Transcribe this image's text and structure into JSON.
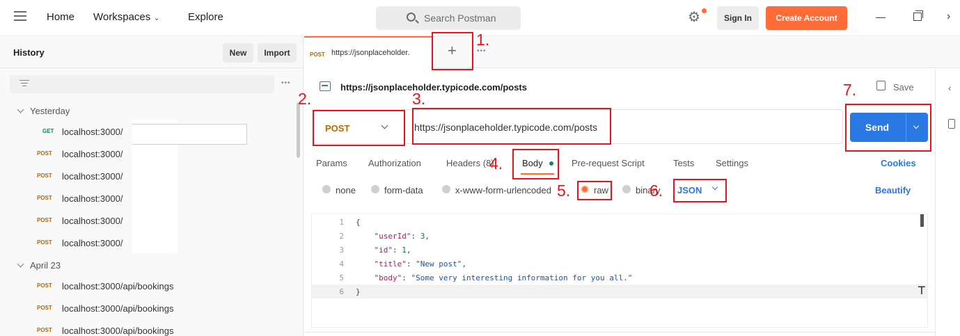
{
  "topbar": {
    "nav": [
      "Home",
      "Workspaces",
      "Explore"
    ],
    "search_placeholder": "Search Postman",
    "sign_in": "Sign In",
    "create_account": "Create Account",
    "close_glyph": "›"
  },
  "sidebar": {
    "title": "History",
    "new": "New",
    "import": "Import",
    "groups": [
      {
        "label": "Yesterday",
        "items": [
          {
            "method": "GET",
            "url": "localhost:3000/"
          },
          {
            "method": "POST",
            "url": "localhost:3000/"
          },
          {
            "method": "POST",
            "url": "localhost:3000/"
          },
          {
            "method": "POST",
            "url": "localhost:3000/"
          },
          {
            "method": "POST",
            "url": "localhost:3000/"
          },
          {
            "method": "POST",
            "url": "localhost:3000/"
          }
        ]
      },
      {
        "label": "April 23",
        "items": [
          {
            "method": "POST",
            "url": "localhost:3000/api/bookings"
          },
          {
            "method": "POST",
            "url": "localhost:3000/api/bookings"
          },
          {
            "method": "POST",
            "url": "localhost:3000/api/bookings"
          }
        ]
      }
    ]
  },
  "tabs": {
    "active": {
      "method": "POST",
      "url": "https://jsonplaceholder."
    },
    "plus": "+",
    "more": "•••"
  },
  "request": {
    "title": "https://jsonplaceholder.typicode.com/posts",
    "save": "Save",
    "method": "POST",
    "url": "https://jsonplaceholder.typicode.com/posts",
    "send": "Send",
    "tabs": [
      "Params",
      "Authorization",
      "Headers (8)",
      "Body",
      "Pre-request Script",
      "Tests",
      "Settings"
    ],
    "cookies": "Cookies",
    "body_types": [
      "none",
      "form-data",
      "x-www-form-urlencoded",
      "raw",
      "binary"
    ],
    "selected_body_type": "raw",
    "format": "JSON",
    "beautify": "Beautify",
    "code_lines": [
      {
        "n": "1",
        "text": "{"
      },
      {
        "n": "2",
        "key": "\"userId\"",
        "val": "3",
        "vtype": "n",
        "comma": ","
      },
      {
        "n": "3",
        "key": "\"id\"",
        "val": "1",
        "vtype": "n",
        "comma": ","
      },
      {
        "n": "4",
        "key": "\"title\"",
        "val": "\"New post\"",
        "vtype": "s",
        "comma": ","
      },
      {
        "n": "5",
        "key": "\"body\"",
        "val": "\"Some very interesting information for you all.\"",
        "vtype": "s",
        "comma": ""
      },
      {
        "n": "6",
        "text": "}"
      }
    ]
  },
  "annotations": [
    "1.",
    "2.",
    "3.",
    "4.",
    "5.",
    "6.",
    "7."
  ],
  "colors": {
    "accent": "#ff6c37",
    "primary": "#2b78e4",
    "post": "#b56b00",
    "get": "#0c8a50",
    "annotation": "#e8141c"
  }
}
